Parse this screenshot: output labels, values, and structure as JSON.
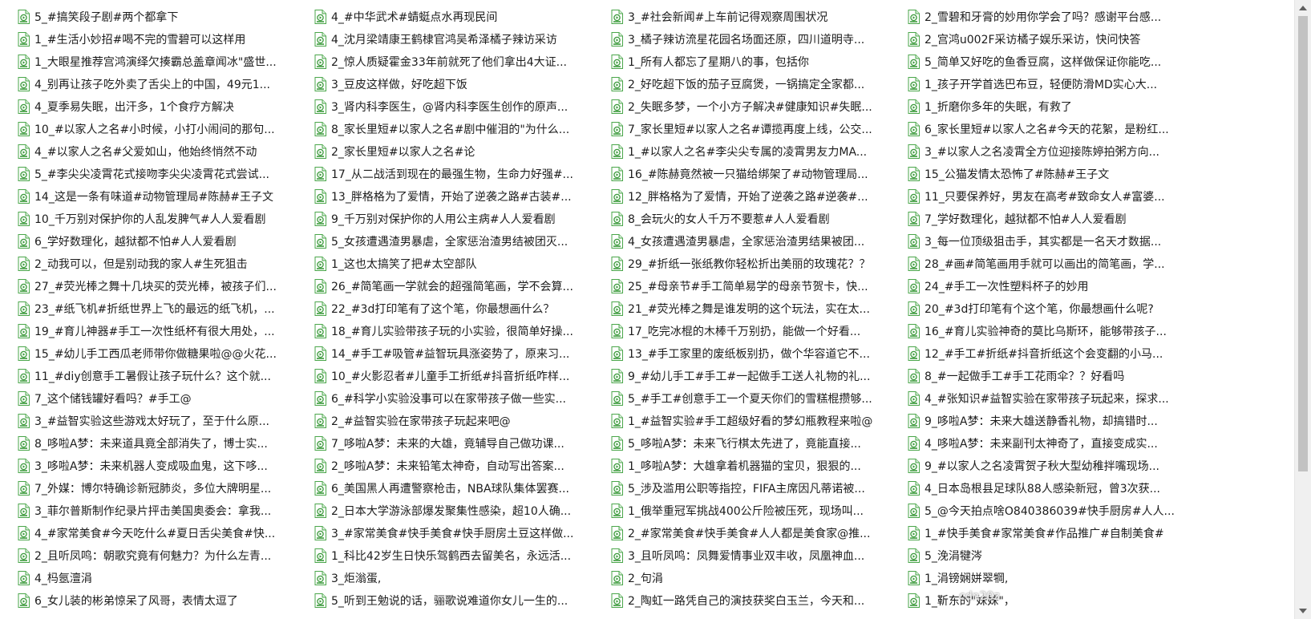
{
  "scrollbar": {
    "position_fraction": 0.0
  },
  "overlay_text": "cdn20z",
  "columns": [
    {
      "files": [
        "5_#搞笑段子剧#两个都拿下",
        "1_#生活小妙招#喝不完的雪碧可以这样用",
        "1_大眼星推荐宫鸿演绎欠揍霸总盖章闻冰\"盛世...",
        "4_别再让孩子吃外卖了舌尖上的中国，49元1...",
        "4_夏季易失眠，出汗多，1个食疗方解决",
        "10_#以家人之名#小时候，小打小闹间的那句...",
        "4_#以家人之名#父爱如山，他始终悄然不动",
        "5_#李尖尖凌霄花式接吻李尖尖凌霄花式尝试...",
        "14_这是一条有味道#动物管理局#陈赫#王子文",
        "10_千万别对保护你的人乱发脾气#人人爱看剧",
        "6_学好数理化，越狱都不怕#人人爱看剧",
        "2_动我可以，但是别动我的家人#生死狙击",
        "27_#荧光棒之舞十几块买的荧光棒，被孩子们...",
        "23_#纸飞机#折纸世界上飞的最远的纸飞机，...",
        "19_#育儿神器#手工一次性纸杯有很大用处，...",
        "15_#幼儿手工西瓜老师带你做糖果啦@@火花...",
        "11_#diy创意手工暑假让孩子玩什么？这个就...",
        "7_这个储钱罐好看吗？#手工@",
        "3_#益智实验这些游戏太好玩了，至于什么原...",
        "8_哆啦A梦：未来道具竟全部消失了，博士实...",
        "3_哆啦A梦：未来机器人变成吸血鬼，这下哆...",
        "7_外媒：博尔特确诊新冠肺炎，多位大牌明星...",
        "3_菲尔普斯制作纪录片抨击美国奥委会：拿我...",
        "4_#家常美食#今天吃什么#夏日舌尖美食#快...",
        "2_且听凤鸣：朝歌究竟有何魅力？为什么左青...",
        "4_杩氬澶涓",
        "6_女儿装的彬弟惊呆了风哥，表情太逗了"
      ]
    },
    {
      "files": [
        "4_#中华武术#蜻蜓点水再现民间",
        "4_沈月梁靖康王鹤棣官鸿吴希泽橘子辣访采访",
        "2_惊人质疑霍金33年前就死了他们拿出4大证...",
        "3_豆皮这样做，好吃超下饭",
        "3_肾内科李医生，@肾内科李医生创作的原声...",
        "8_家长里短#以家人之名#剧中催泪的\"为什么...",
        "2_家长里短#以家人之名#论",
        "17_从二战活到现在的最强生物，生命力好强#...",
        "13_胖格格为了爱情，开始了逆袭之路#古装#...",
        "9_千万别对保护你的人用公主病#人人爱看剧",
        "5_女孩遭遇渣男暴虐，全家惩治渣男结被团灭...",
        "1_这也太搞笑了把#太空部队",
        "26_#简笔画一学就会的超强简笔画，学不会算...",
        "22_#3d打印笔有了这个笔，你最想画什么？",
        "18_#育儿实验带孩子玩的小实验，很简单好操...",
        "14_#手工#吸管#益智玩具涨姿势了，原来习...",
        "10_#火影忍者#儿童手工折纸#抖音折纸咋样...",
        "6_#科学小实验没事可以在家带孩子做一些实...",
        "2_#益智实验在家带孩子玩起来吧@",
        "7_哆啦A梦：未来的大雄，竟辅导自己做功课...",
        "2_哆啦A梦：未来铅笔太神奇，自动写出答案...",
        "6_美国黑人再遭警察枪击，NBA球队集体罢赛...",
        "2_日本大学游泳部爆发聚集性感染，超10人确...",
        "3_#家常美食#快手美食#快手厨房土豆这样做...",
        "1_科比42岁生日快乐驾鹤西去留美名，永远活...",
        "3_炬滃蛋,",
        "5_听到王勉说的话，骊歌说难道你女儿一生的..."
      ]
    },
    {
      "files": [
        "3_#社会新闻#上车前记得观察周围状况",
        "3_橘子辣访流星花园名场面还原，四川道明寺...",
        "1_所有人都忘了星期八的事，包括你",
        "2_好吃超下饭的茄子豆腐煲，一锅搞定全家都...",
        "2_失眠多梦，一个小方子解决#健康知识#失眠...",
        "7_家长里短#以家人之名#谭揽再度上线，公交...",
        "1_#以家人之名#李尖尖专属的凌霄男友力MA...",
        "16_#陈赫竟然被一只猫给绑架了#动物管理局...",
        "12_胖格格为了爱情，开始了逆袭之路#逆袭#...",
        "8_会玩火的女人千万不要惹#人人爱看剧",
        "4_女孩遭遇渣男暴虐，全家惩治渣男结果被团...",
        "29_#折纸一张纸教你轻松折出美丽的玫瑰花？？",
        "25_#母亲节#手工简单易学的母亲节贺卡，快...",
        "21_#荧光棒之舞是谁发明的这个玩法，实在太...",
        "17_吃完冰棍的木棒千万别扔，能做一个好看...",
        "13_#手工家里的废纸板别扔，做个华容道它不...",
        "9_#幼儿手工#手工#一起做手工送人礼物的礼...",
        "5_#手工#创意手工一个夏天你们的雪糕棍攒够...",
        "1_#益智实验#手工超级好看的梦幻瓶教程来啦@",
        "5_哆啦A梦：未来飞行棋太先进了，竟能直接...",
        "1_哆啦A梦：大雄拿着机器猫的宝贝，狠狠的...",
        "5_涉及滥用公职等指控，FIFA主席因凡蒂诺被...",
        "1_俄举重冠军挑战400公斤险被压死，现场叫...",
        "2_#家常美食#快手美食#人人都是美食家@推...",
        "3_且听凤鸣：凤舞爱情事业双丰收，凤凰神血...",
        "2_句涓",
        "2_陶虹一路凭自己的演技获奖白玉兰，今天和..."
      ]
    },
    {
      "files": [
        "2_雪碧和牙膏的妙用你学会了吗？感谢平台感...",
        "2_宫鸿u002F采访橘子娱乐采访，快问快答",
        "5_简单又好吃的鱼香豆腐，这样做保证你能吃...",
        "1_孩子开学首选巴布豆，轻便防滑MD实心大...",
        "1_折磨你多年的失眠，有救了",
        "6_家长里短#以家人之名#今天的花絮，是粉红...",
        "3_#以家人之名凌霄全方位迎接陈婷拍粥方向...",
        "15_公猫发情太恐怖了#陈赫#王子文",
        "11_只要保养好，男友在高考#致命女人#富婆...",
        "7_学好数理化，越狱都不怕#人人爱看剧",
        "3_每一位顶级狙击手，其实都是一名天才数据...",
        "28_#画#简笔画用手就可以画出的简笔画，学...",
        "24_#手工一次性塑料杯子的妙用",
        "20_#3d打印笔有个这个笔，你最想画什么呢?",
        "16_#育儿实验神奇的莫比乌斯环，能够带孩子...",
        "12_#手工#折纸#抖音折纸这个会变翻的小马...",
        "8_#一起做手工#手工花雨伞？？好看吗",
        "4_#张知识#益智实验在家带孩子玩起来，探求...",
        "9_哆啦A梦：未来大雄送静香礼物，却搞错时...",
        "4_哆啦A梦：未来副刊太神奇了，直接变成实...",
        "9_#以家人之名凌霄贺子秋大型幼稚拌嘴现场...",
        "4_日本岛根县足球队88人感染新冠，曾3次获...",
        "5_@今天拍点啥O840386039#快手厨房#人人...",
        "1_#快手美食#家常美食#作品推广#自制美食#",
        "5_浼涓犍涔",
        "1_涓镑娴姘翠犅,",
        "1_靳东的\"妹妹\"，"
      ]
    }
  ]
}
